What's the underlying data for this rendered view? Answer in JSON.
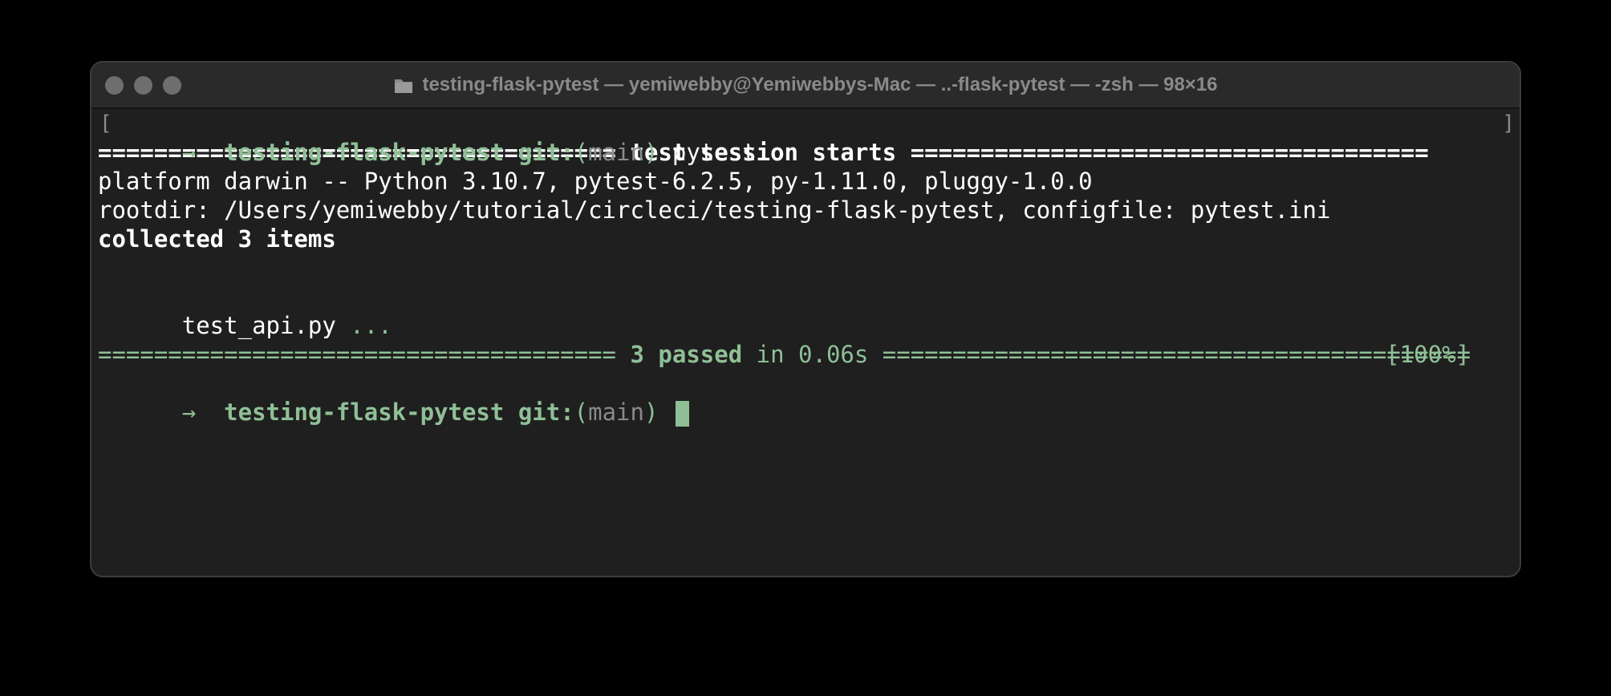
{
  "window": {
    "title": "testing-flask-pytest — yemiwebby@Yemiwebbys-Mac — ..-flask-pytest — -zsh — 98×16",
    "colors": {
      "background": "#1f1f1f",
      "titlebar": "#2a2a2a",
      "accent_green": "#8fbf96",
      "dim": "#8a8a8a",
      "text": "#ffffff"
    },
    "folder_icon": "folder-icon"
  },
  "terminal": {
    "prompt_arrow": "→",
    "prompt_dir": "testing-flask-pytest",
    "prompt_git": "git:",
    "prompt_branch_open": "(",
    "prompt_branch": "main",
    "prompt_branch_close": ")",
    "command": "pytest",
    "session_rule_left": "=====================================",
    "session_header": "test session starts",
    "session_rule_right": "=====================================",
    "platform_line": "platform darwin -- Python 3.10.7, pytest-6.2.5, py-1.11.0, pluggy-1.0.0",
    "rootdir_line": "rootdir: /Users/yemiwebby/tutorial/circleci/testing-flask-pytest, configfile: pytest.ini",
    "collected_line": "collected 3 items",
    "test_file": "test_api.py",
    "test_dots": "...",
    "test_percent": "[100%]",
    "summary_rule_left": "=====================================",
    "summary_passed": "3 passed",
    "summary_time": "in 0.06s",
    "summary_rule_right": "=========================================="
  }
}
